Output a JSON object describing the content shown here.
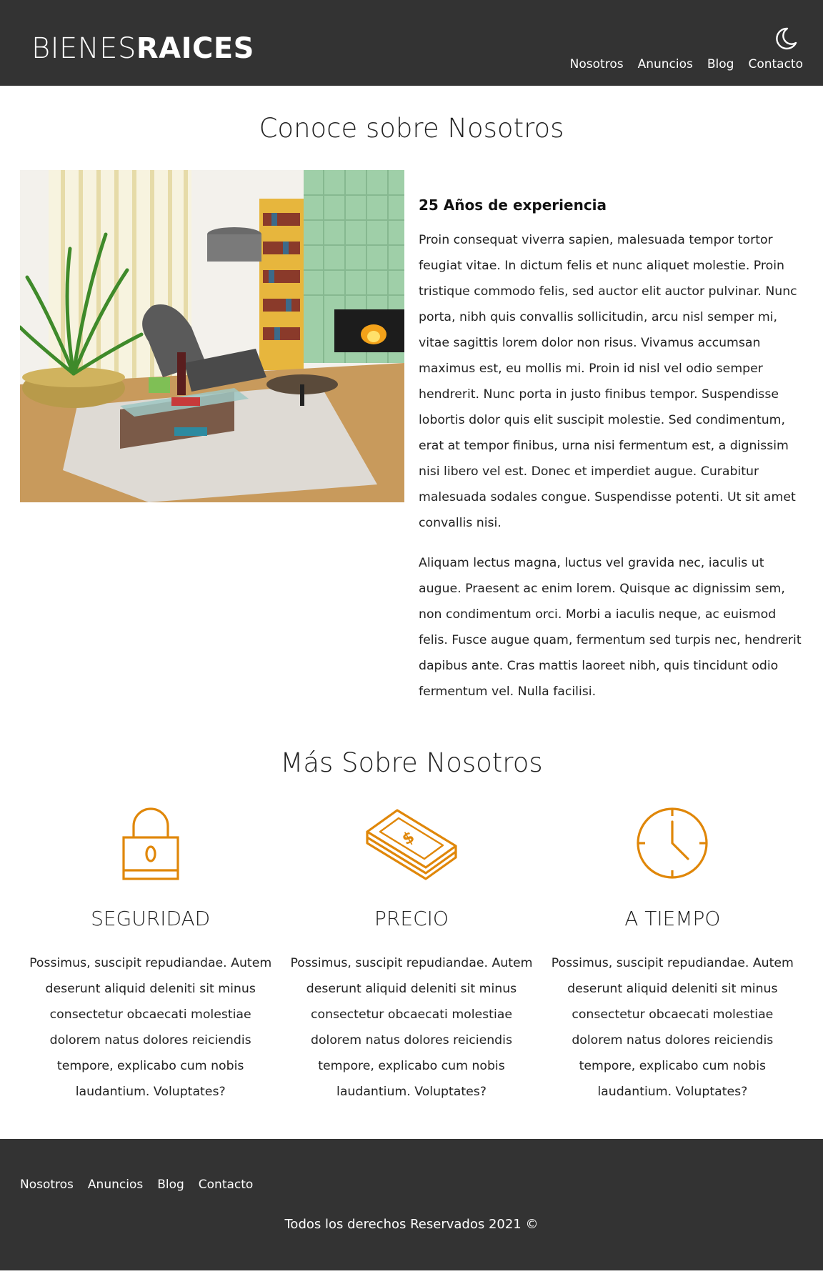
{
  "header": {
    "logo_light": "BIENES",
    "logo_bold": "RAICES",
    "nav": [
      {
        "label": "Nosotros"
      },
      {
        "label": "Anuncios"
      },
      {
        "label": "Blog"
      },
      {
        "label": "Contacto"
      }
    ],
    "theme_icon": "moon-icon"
  },
  "about": {
    "title": "Conoce sobre Nosotros",
    "image_alt": "living-room-photo",
    "heading": "25 Años de experiencia",
    "paragraphs": [
      "Proin consequat viverra sapien, malesuada tempor tortor feugiat vitae. In dictum felis et nunc aliquet molestie. Proin tristique commodo felis, sed auctor elit auctor pulvinar. Nunc porta, nibh quis convallis sollicitudin, arcu nisl semper mi, vitae sagittis lorem dolor non risus. Vivamus accumsan maximus est, eu mollis mi. Proin id nisl vel odio semper hendrerit. Nunc porta in justo finibus tempor. Suspendisse lobortis dolor quis elit suscipit molestie. Sed condimentum, erat at tempor finibus, urna nisi fermentum est, a dignissim nisi libero vel est. Donec et imperdiet augue. Curabitur malesuada sodales congue. Suspendisse potenti. Ut sit amet convallis nisi.",
      "Aliquam lectus magna, luctus vel gravida nec, iaculis ut augue. Praesent ac enim lorem. Quisque ac dignissim sem, non condimentum orci. Morbi a iaculis neque, ac euismod felis. Fusce augue quam, fermentum sed turpis nec, hendrerit dapibus ante. Cras mattis laoreet nibh, quis tincidunt odio fermentum vel. Nulla facilisi."
    ]
  },
  "more": {
    "title": "Más Sobre Nosotros",
    "features": [
      {
        "icon": "lock-icon",
        "title": "SEGURIDAD",
        "text": "Possimus, suscipit repudiandae. Autem deserunt aliquid deleniti sit minus consectetur obcaecati molestiae dolorem natus dolores reiciendis tempore, explicabo cum nobis laudantium. Voluptates?"
      },
      {
        "icon": "money-icon",
        "title": "PRECIO",
        "text": "Possimus, suscipit repudiandae. Autem deserunt aliquid deleniti sit minus consectetur obcaecati molestiae dolorem natus dolores reiciendis tempore, explicabo cum nobis laudantium. Voluptates?"
      },
      {
        "icon": "clock-icon",
        "title": "A TIEMPO",
        "text": "Possimus, suscipit repudiandae. Autem deserunt aliquid deleniti sit minus consectetur obcaecati molestiae dolorem natus dolores reiciendis tempore, explicabo cum nobis laudantium. Voluptates?"
      }
    ]
  },
  "footer": {
    "nav": [
      {
        "label": "Nosotros"
      },
      {
        "label": "Anuncios"
      },
      {
        "label": "Blog"
      },
      {
        "label": "Contacto"
      }
    ],
    "copyright": "Todos los derechos Reservados 2021 ©"
  },
  "colors": {
    "header_bg": "#333333",
    "accent": "#e08709",
    "text": "#222222"
  }
}
